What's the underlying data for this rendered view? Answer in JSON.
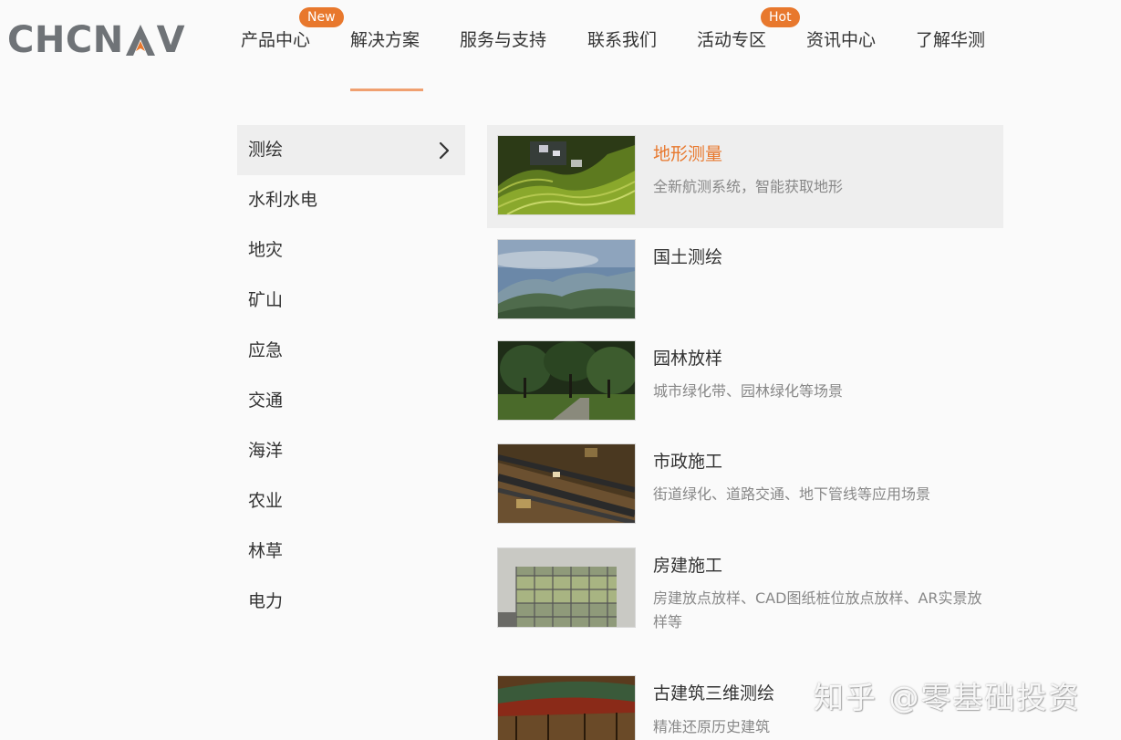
{
  "brand": {
    "logo_text_left": "CHCN",
    "logo_text_right": "V",
    "accent": "#e8782d",
    "logo_color": "#6f7377"
  },
  "nav": {
    "items": [
      {
        "label": "产品中心",
        "badge": "New"
      },
      {
        "label": "解决方案",
        "active": true
      },
      {
        "label": "服务与支持"
      },
      {
        "label": "联系我们"
      },
      {
        "label": "活动专区",
        "badge": "Hot"
      },
      {
        "label": "资讯中心"
      },
      {
        "label": "了解华测"
      }
    ]
  },
  "categories": [
    {
      "label": "测绘",
      "active": true
    },
    {
      "label": "水利水电"
    },
    {
      "label": "地灾"
    },
    {
      "label": "矿山"
    },
    {
      "label": "应急"
    },
    {
      "label": "交通"
    },
    {
      "label": "海洋"
    },
    {
      "label": "农业"
    },
    {
      "label": "林草"
    },
    {
      "label": "电力"
    }
  ],
  "solutions": [
    {
      "title": "地形测量",
      "desc": "全新航测系统，智能获取地形",
      "active": true,
      "image": "terraced-hills-photo"
    },
    {
      "title": "国土测绘",
      "desc": "",
      "image": "mountain-mist-photo"
    },
    {
      "title": "园林放样",
      "desc": "城市绿化带、园林绿化等场景",
      "image": "park-trees-photo"
    },
    {
      "title": "市政施工",
      "desc": "街道绿化、道路交通、地下管线等应用场景",
      "image": "road-construction-photo"
    },
    {
      "title": "房建施工",
      "desc": "房建放点放样、CAD图纸桩位放点放样、AR实景放样等",
      "image": "scaffolding-building-photo"
    },
    {
      "title": "古建筑三维测绘",
      "desc": "精准还原历史建筑",
      "image": "ancient-architecture-photo"
    }
  ],
  "watermark": "知乎 @零基础投资"
}
